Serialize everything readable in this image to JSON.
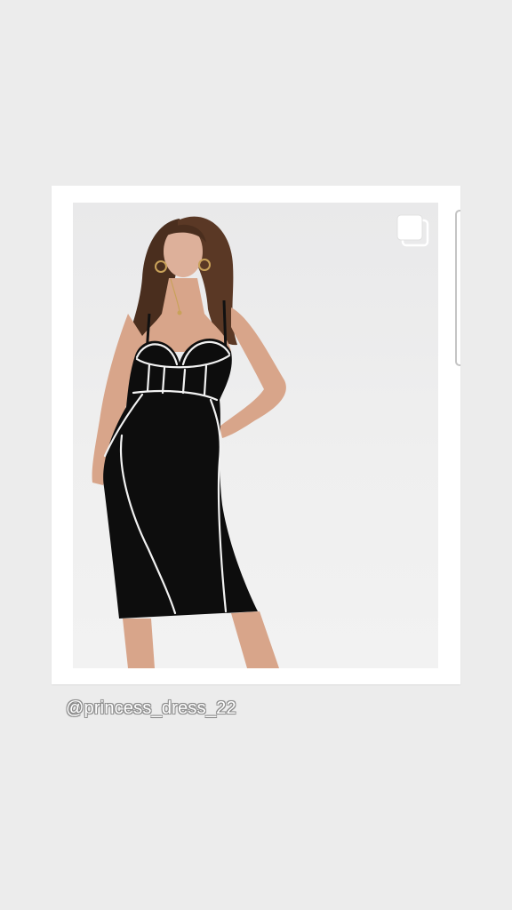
{
  "post": {
    "username": "@princess_dress_22",
    "photo_icon": "multiple-images-icon",
    "photo_subject": "model-in-black-midi-dress-image"
  },
  "colors": {
    "background": "#ececec",
    "card": "#ffffff",
    "dress": "#0d0d0d",
    "piping": "#f2f2f2",
    "skin": "#d8a58a",
    "hair": "#4a2e1e"
  }
}
